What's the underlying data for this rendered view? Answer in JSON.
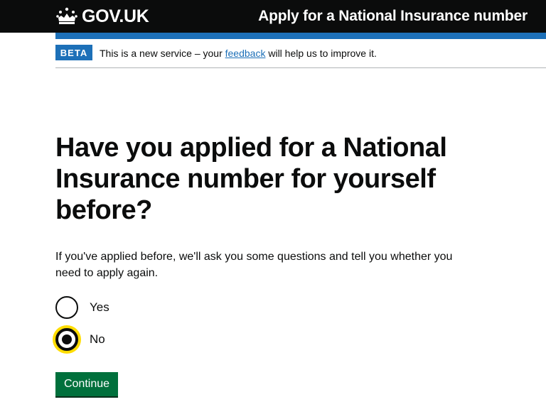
{
  "header": {
    "logo_text": "GOV.UK",
    "logo_icon": "crown-icon",
    "service_name": "Apply for a National Insurance number"
  },
  "phase_banner": {
    "tag": "BETA",
    "text_before": "This is a new service – your ",
    "link_text": "feedback",
    "text_after": " will help us to improve it."
  },
  "question": {
    "heading": "Have you applied for a National Insurance number for yourself before?",
    "hint": "If you've applied before, we'll ask you some questions and tell you whether you need to apply again.",
    "options": [
      {
        "label": "Yes",
        "selected": false
      },
      {
        "label": "No",
        "selected": true
      }
    ]
  },
  "button": {
    "label": "Continue"
  },
  "colors": {
    "header_bg": "#0b0c0c",
    "accent_blue": "#1d70b8",
    "button_green": "#00703c",
    "focus_yellow": "#ffdd00"
  }
}
